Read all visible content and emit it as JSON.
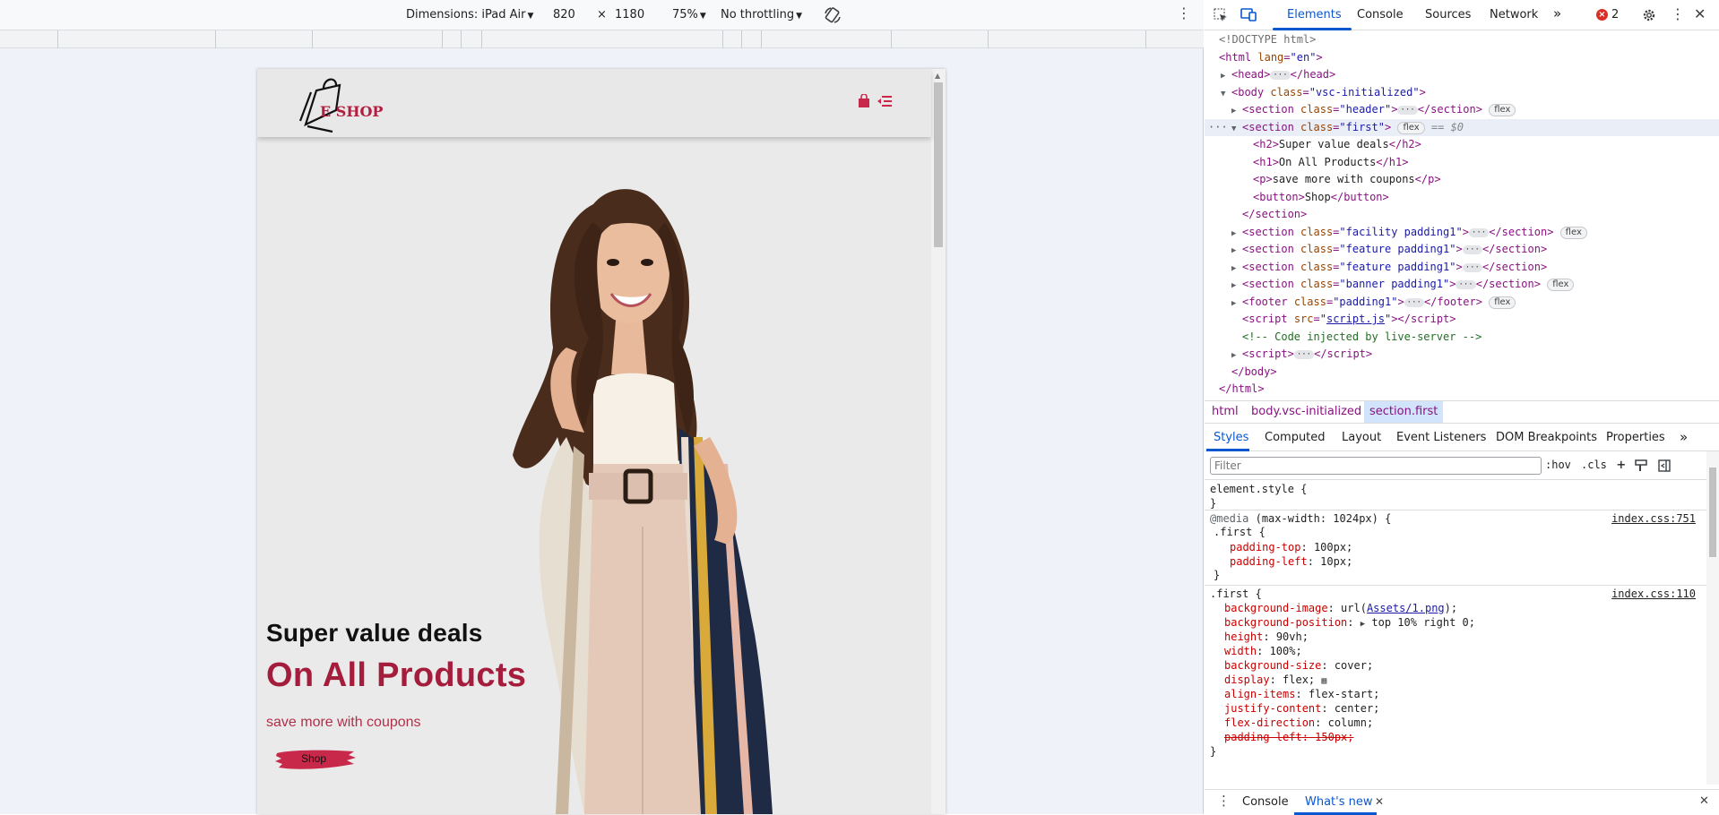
{
  "device_toolbar": {
    "dimensions_label": "Dimensions: iPad Air",
    "width": "820",
    "times": "×",
    "height": "1180",
    "zoom": "75%",
    "throttling": "No throttling"
  },
  "site": {
    "logo_text": "E SHOP",
    "hero": {
      "h2": "Super value deals",
      "h1": "On All Products",
      "p": "save more with coupons",
      "button": "Shop"
    }
  },
  "devtools": {
    "tabs": [
      "Elements",
      "Console",
      "Sources",
      "Network"
    ],
    "more_tabs": "»",
    "error_count": "2",
    "dom": {
      "doctype": "<!DOCTYPE html>",
      "html_open_tag": "html",
      "html_attr": "lang",
      "html_attr_val": "\"en\"",
      "head": "head",
      "body_tag": "body",
      "body_attr": "class",
      "body_attr_val": "\"vsc-initialized\"",
      "sections": [
        {
          "tag": "section",
          "cls": "\"header\"",
          "pill": "flex"
        },
        {
          "tag": "section",
          "cls": "\"first\"",
          "pill": "flex",
          "selected_marker": "== $0"
        },
        {
          "tag": "section",
          "cls": "\"facility padding1\"",
          "pill": "flex"
        },
        {
          "tag": "section",
          "cls": "\"feature padding1\"",
          "pill": ""
        },
        {
          "tag": "section",
          "cls": "\"feature padding1\"",
          "pill": ""
        },
        {
          "tag": "section",
          "cls": "\"banner padding1\"",
          "pill": "flex"
        },
        {
          "tag": "footer",
          "cls": "\"padding1\"",
          "pill": "flex"
        }
      ],
      "children": [
        {
          "tag": "h2",
          "text": "Super value deals"
        },
        {
          "tag": "h1",
          "text": "On All Products"
        },
        {
          "tag": "p",
          "text": "save more with coupons"
        },
        {
          "tag": "button",
          "text": "Shop"
        }
      ],
      "section_close": "</section>",
      "script_src": "script.js",
      "comment": "<!-- Code injected by live-server -->",
      "script_tag": "script",
      "body_close": "</body>",
      "html_close": "</html>"
    },
    "breadcrumb": [
      "html",
      "body.vsc-initialized",
      "section.first"
    ],
    "sub_tabs": [
      "Styles",
      "Computed",
      "Layout",
      "Event Listeners",
      "DOM Breakpoints",
      "Properties"
    ],
    "filter_placeholder": "Filter",
    "filter_hov": ":hov",
    "filter_cls": ".cls",
    "styles": {
      "element_style": "element.style {",
      "close_brace": "}",
      "media_at": "@media",
      "media_query": "(max-width: 1024px) {",
      "media_selector": ".first {",
      "media_src": "index.css:751",
      "media_props": [
        {
          "name": "padding-top",
          "value": "100px;"
        },
        {
          "name": "padding-left",
          "value": "10px;"
        }
      ],
      "rule_selector": ".first {",
      "rule_src": "index.css:110",
      "rule_props": [
        {
          "name": "background-image",
          "value_pre": "url(",
          "value_link": "Assets/1.png",
          "value_post": ");"
        },
        {
          "name": "background-position",
          "value": "top 10% right 0;"
        },
        {
          "name": "height",
          "value": "90vh;"
        },
        {
          "name": "width",
          "value": "100%;"
        },
        {
          "name": "background-size",
          "value": "cover;"
        },
        {
          "name": "display",
          "value": "flex;"
        },
        {
          "name": "align-items",
          "value": "flex-start;"
        },
        {
          "name": "justify-content",
          "value": "center;"
        },
        {
          "name": "flex-direction",
          "value": "column;"
        },
        {
          "name": "padding-left",
          "value": "150px;"
        }
      ]
    },
    "drawer_tabs": [
      "Console",
      "What's new"
    ]
  }
}
